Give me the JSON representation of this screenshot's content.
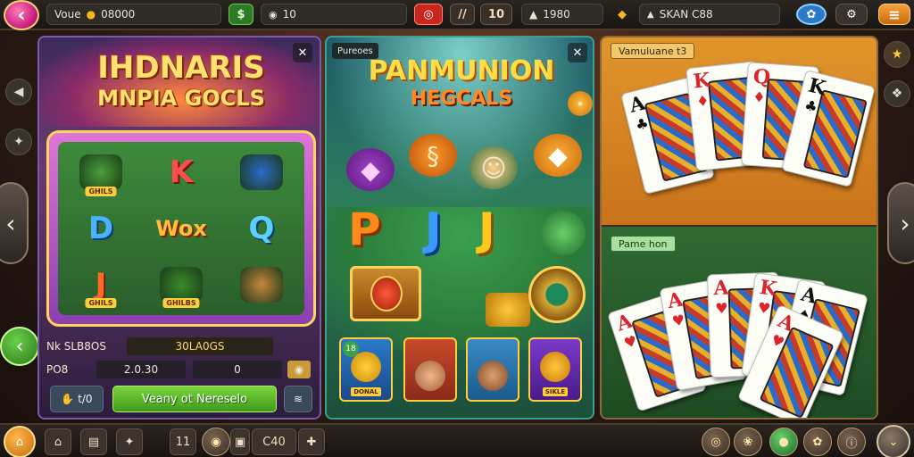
{
  "topbar": {
    "volume_label": "Voue",
    "balance": "08000",
    "counter": "10",
    "score": "1980",
    "player": "SKAN C88",
    "icons": [
      "back-icon",
      "drop-icon",
      "cash-icon",
      "chip-icon",
      "dice-icon",
      "layers-icon",
      "pot-icon",
      "shield-icon",
      "gem-icon",
      "key-icon",
      "menu-icon"
    ]
  },
  "slots": {
    "title_line1": "IHDNARIS",
    "title_line2": "MNPIA GOCLS",
    "reels": [
      {
        "text": "",
        "kind": "blob",
        "chip": "GHILS"
      },
      {
        "text": "K",
        "kind": "k",
        "chip": ""
      },
      {
        "text": "",
        "kind": "box",
        "chip": ""
      },
      {
        "text": "D",
        "kind": "d",
        "chip": ""
      },
      {
        "text": "Wox",
        "kind": "wild",
        "chip": ""
      },
      {
        "text": "Q",
        "kind": "q",
        "chip": ""
      },
      {
        "text": "J",
        "kind": "j",
        "chip": "GHILS"
      },
      {
        "text": "",
        "kind": "leaf",
        "chip": "GHILBS"
      },
      {
        "text": "",
        "kind": "bear",
        "chip": ""
      }
    ],
    "label_bet": "Nk SLB8OS",
    "value_bet": "30LA0GS",
    "label_pos": "PO8",
    "value_pos": "2.0.30",
    "value_zero": "0",
    "btn_left": "t/0",
    "btn_main": "Veany ot Nereselo"
  },
  "fish": {
    "tag": "Pureoes",
    "title_line1": "PANMUNION",
    "title_line2": "HEGCALS",
    "letters": [
      "P",
      "J",
      "J"
    ],
    "chars": [
      {
        "chip": "DONAL",
        "badge": "18"
      },
      {
        "chip": "",
        "badge": ""
      },
      {
        "chip": "",
        "badge": ""
      },
      {
        "chip": "SIKLE",
        "badge": ""
      }
    ]
  },
  "cards": {
    "top_tag": "Vamuluane t3",
    "bottom_tag": "Pame hon",
    "top_hand": [
      {
        "rank": "A",
        "suit": "♣",
        "color": "blk"
      },
      {
        "rank": "K",
        "suit": "♦",
        "color": "red"
      },
      {
        "rank": "Q",
        "suit": "♦",
        "color": "red"
      },
      {
        "rank": "K",
        "suit": "♣",
        "color": "blk"
      }
    ],
    "bottom_hand": [
      {
        "rank": "A",
        "suit": "♥",
        "color": "red"
      },
      {
        "rank": "A",
        "suit": "♥",
        "color": "red"
      },
      {
        "rank": "A",
        "suit": "♥",
        "color": "red"
      },
      {
        "rank": "K",
        "suit": "♥",
        "color": "red"
      },
      {
        "rank": "A",
        "suit": "♠",
        "color": "blk"
      },
      {
        "rank": "A",
        "suit": "♥",
        "color": "red"
      }
    ]
  },
  "bottombar": {
    "num1": "11",
    "num2": "C40"
  },
  "colors": {
    "accent_gold": "#ffd36a",
    "primary_green": "#3e9a1c",
    "magenta": "#c2187a"
  }
}
